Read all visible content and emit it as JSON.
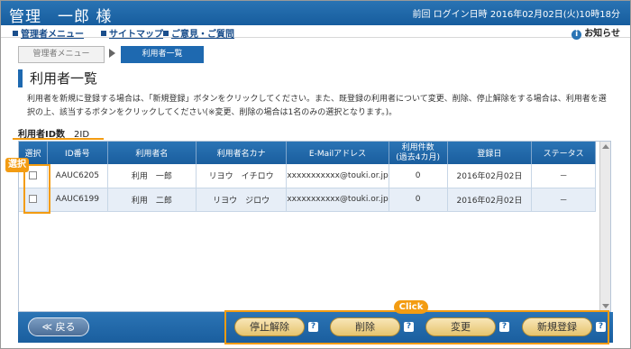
{
  "header": {
    "user": "管理　一郎 様",
    "last_login": "前回 ログイン日時 2016年02月02日(火)10時18分"
  },
  "menu": {
    "items": [
      "管理者メニュー",
      "サイトマップ",
      "ご意見・ご質問"
    ],
    "notice": "お知らせ"
  },
  "breadcrumb": {
    "parent": "管理者メニュー",
    "current": "利用者一覧"
  },
  "page": {
    "title": "利用者一覧",
    "description": "利用者を新規に登録する場合は、「新規登録」ボタンをクリックしてください。また、既登録の利用者について変更、削除、停止解除をする場合は、利用者を選択の上、該当するボタンをクリックしてください(※変更、削除の場合は1名のみの選択となります。)。",
    "count_label": "利用者ID数",
    "count_value": "2ID"
  },
  "table": {
    "headers": [
      "選択",
      "ID番号",
      "利用者名",
      "利用者名カナ",
      "E-Mailアドレス",
      "利用件数\n(過去4カ月)",
      "登録日",
      "ステータス"
    ],
    "rows": [
      [
        "",
        "AAUC6205",
        "利用　一郎",
        "リヨウ　イチロウ",
        "xxxxxxxxxxx@touki.or.jp",
        "0",
        "2016年02月02日",
        "－"
      ],
      [
        "",
        "AAUC6199",
        "利用　二郎",
        "リヨウ　ジロウ",
        "xxxxxxxxxxx@touki.or.jp",
        "0",
        "2016年02月02日",
        "－"
      ]
    ]
  },
  "annotations": {
    "select_tag": "選択",
    "click_tag": "Click"
  },
  "footer": {
    "back": "≪ 戻る",
    "unsuspend": "停止解除",
    "delete": "削除",
    "change": "変更",
    "register": "新規登録",
    "help": "?"
  },
  "colors": {
    "primary": "#1e69b0",
    "accent": "#f39c12",
    "button": "#e6c46e"
  }
}
